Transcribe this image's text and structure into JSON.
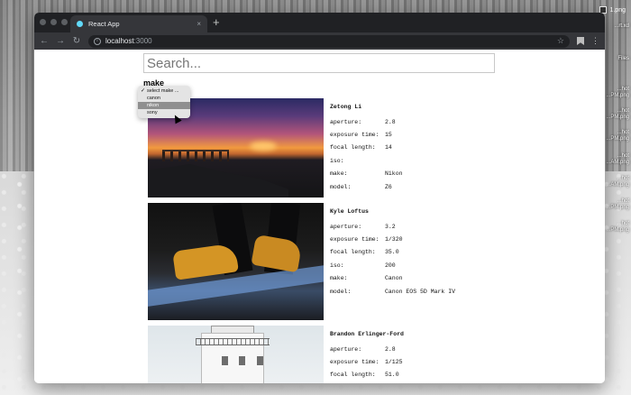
{
  "desktop": {
    "files": [
      "1.png",
      "...rt.xd",
      "Files",
      "...hot",
      "...PM.png",
      "...hot",
      "...PM.png",
      "...hot",
      "...PM.png",
      "...hot",
      "...AM.png",
      "...hot",
      "...AM.png",
      "...hot",
      "...PM.png",
      "...hot",
      "...PM.png"
    ]
  },
  "browser": {
    "tab_title": "React App",
    "tab_close": "×",
    "new_tab": "+",
    "url_host": "localhost",
    "url_port": ":3000"
  },
  "search": {
    "placeholder": "Search..."
  },
  "facet": {
    "label": "make",
    "options": [
      "select make ...",
      "canon",
      "nikon",
      "sony"
    ],
    "checked_index": 0,
    "hover_index": 2
  },
  "field_labels": {
    "aperture": "aperture:",
    "exposure": "exposure time:",
    "focal": "focal length:",
    "iso": "iso:",
    "make": "make:",
    "model": "model:"
  },
  "photos": [
    {
      "author": "Zetong Li",
      "aperture": "2.8",
      "exposure": "15",
      "focal": "14",
      "iso": "",
      "make": "Nikon",
      "model": "Z6"
    },
    {
      "author": "Kyle Loftus",
      "aperture": "3.2",
      "exposure": "1/320",
      "focal": "35.0",
      "iso": "200",
      "make": "Canon",
      "model": "Canon EOS 5D Mark IV"
    },
    {
      "author": "Brandon Erlinger-Ford",
      "aperture": "2.8",
      "exposure": "1/125",
      "focal": "51.0"
    }
  ],
  "colors": {
    "tabbar": "#202124",
    "toolbar": "#35363a",
    "react_favicon": "#61dafb"
  }
}
